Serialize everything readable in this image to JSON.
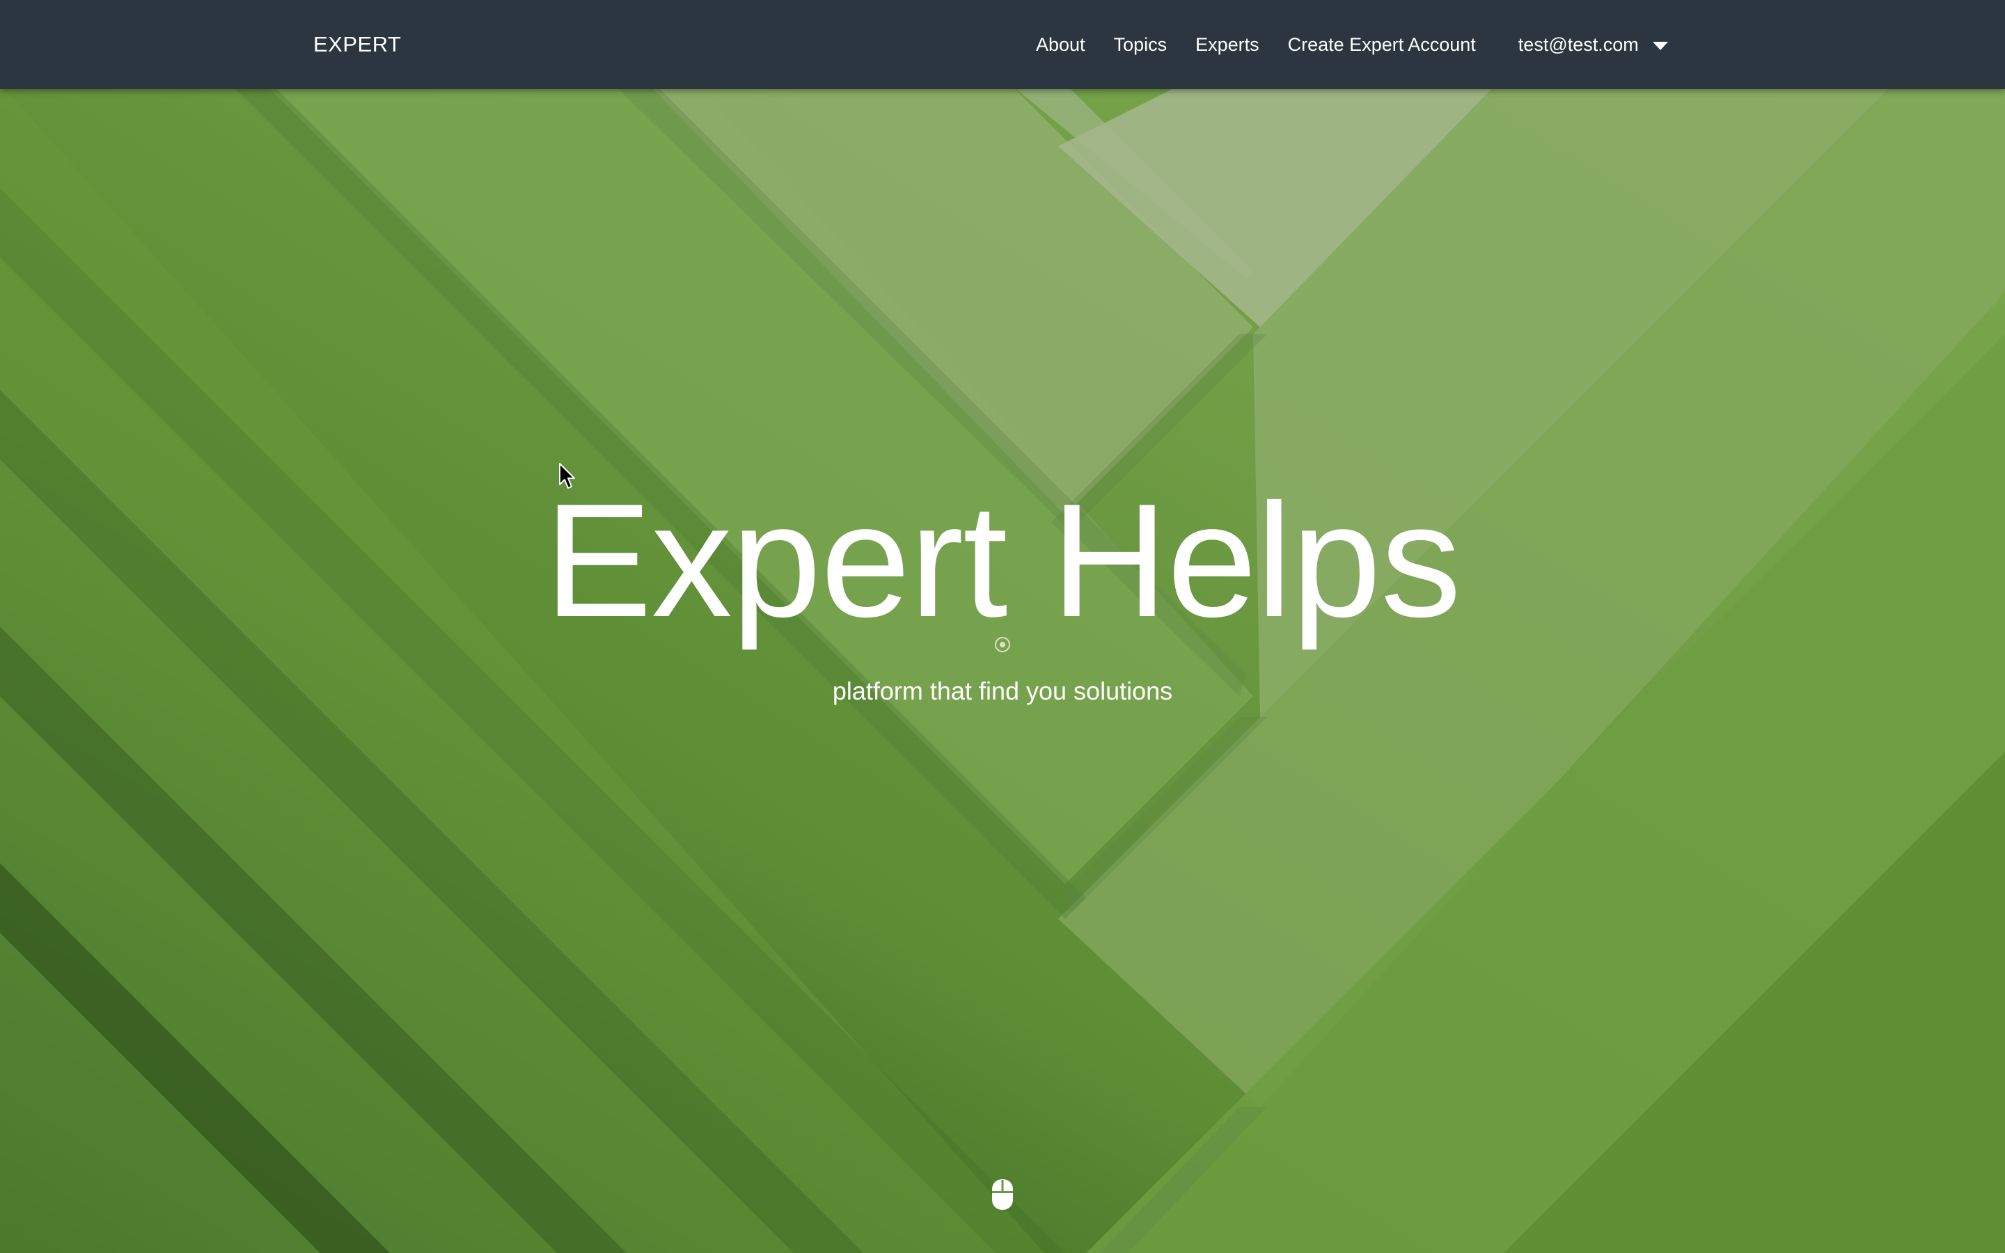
{
  "navbar": {
    "brand": "EXPERT",
    "links": [
      "About",
      "Topics",
      "Experts",
      "Create Expert Account"
    ],
    "user_email": "test@test.com"
  },
  "hero": {
    "title": "Expert Helps",
    "subtitle": "platform that find you solutions"
  },
  "icons": {
    "dropdown": "caret-down-icon",
    "center": "target-icon",
    "scroll": "mouse-scroll-icon",
    "pointer": "mouse-cursor-icon"
  },
  "colors": {
    "navbar_bg": "#2b3640",
    "hero_green": "#6a9a40",
    "hero_dark_green": "#2f5a1c",
    "hero_light": "#a8ba90",
    "text": "#ffffff"
  }
}
